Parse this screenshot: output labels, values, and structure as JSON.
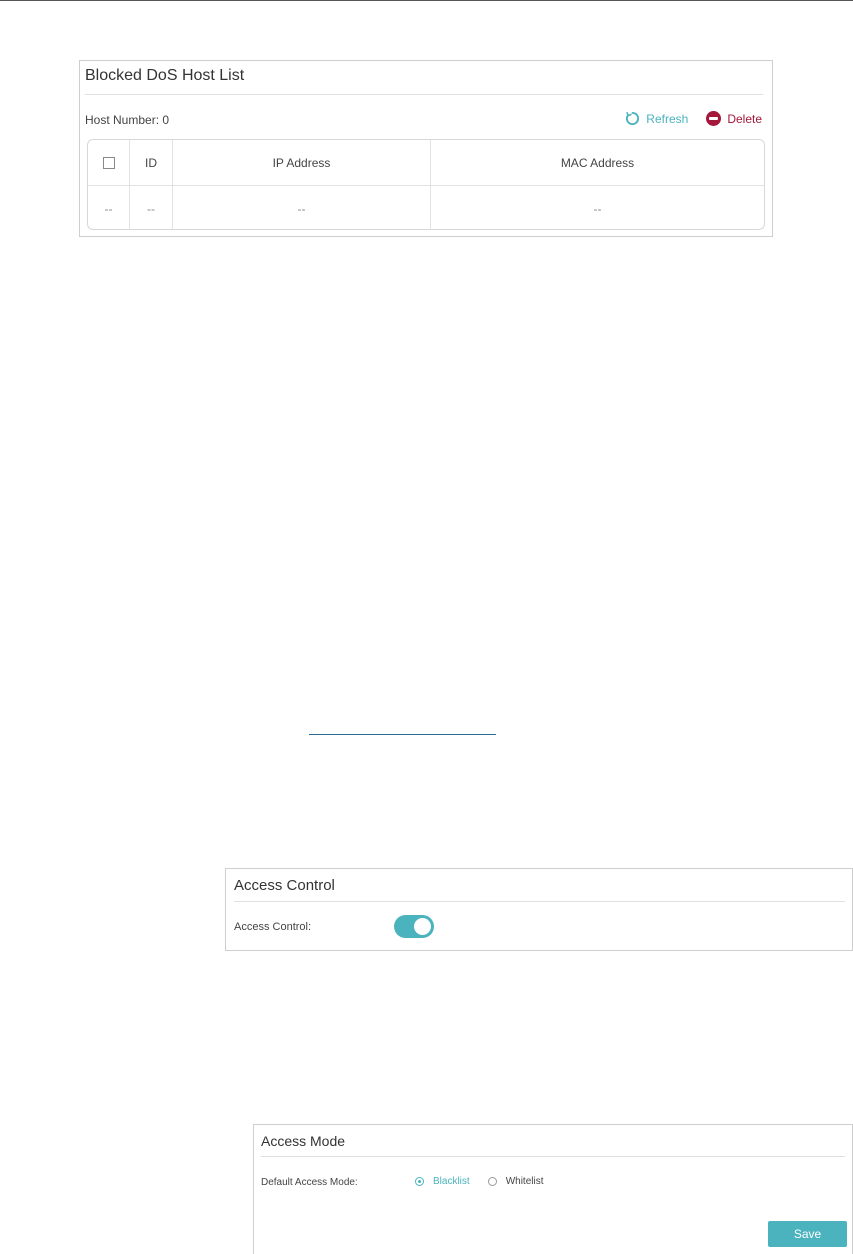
{
  "dos_host_list": {
    "title": "Blocked DoS Host List",
    "host_number_label": "Host Number: 0",
    "refresh_label": "Refresh",
    "delete_label": "Delete",
    "columns": [
      "ID",
      "IP Address",
      "MAC Address"
    ],
    "rows": [
      {
        "select": "--",
        "id": "--",
        "ip": "--",
        "mac": "--"
      }
    ]
  },
  "access_control": {
    "title": "Access Control",
    "label": "Access Control:",
    "enabled": true
  },
  "access_mode": {
    "title": "Access Mode",
    "label": "Default Access Mode:",
    "options": [
      {
        "label": "Blacklist",
        "selected": true
      },
      {
        "label": "Whitelist",
        "selected": false
      }
    ],
    "save_label": "Save"
  },
  "colors": {
    "accent": "#4ab3bd",
    "delete": "#a4183c"
  }
}
